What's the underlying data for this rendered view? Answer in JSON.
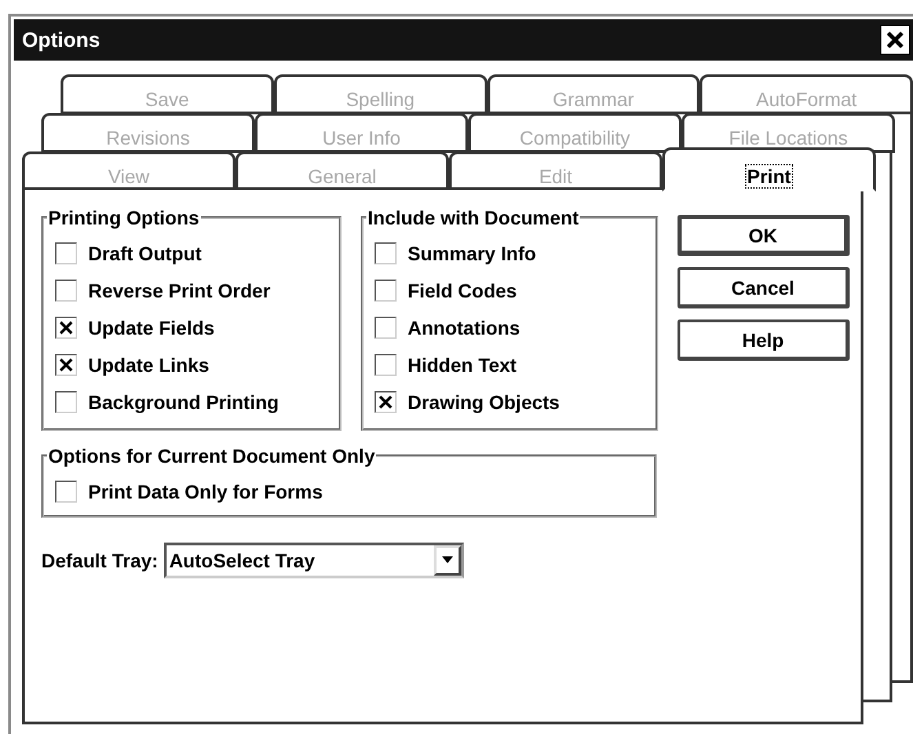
{
  "window": {
    "title": "Options"
  },
  "tab_rows": [
    {
      "tabs": [
        {
          "label": "Save",
          "selected": false,
          "disabled": true
        },
        {
          "label": "Spelling",
          "selected": false,
          "disabled": true
        },
        {
          "label": "Grammar",
          "selected": false,
          "disabled": true
        },
        {
          "label": "AutoFormat",
          "selected": false,
          "disabled": true
        }
      ]
    },
    {
      "tabs": [
        {
          "label": "Revisions",
          "selected": false,
          "disabled": true
        },
        {
          "label": "User Info",
          "selected": false,
          "disabled": true
        },
        {
          "label": "Compatibility",
          "selected": false,
          "disabled": true
        },
        {
          "label": "File Locations",
          "selected": false,
          "disabled": true
        }
      ]
    },
    {
      "tabs": [
        {
          "label": "View",
          "selected": false,
          "disabled": true
        },
        {
          "label": "General",
          "selected": false,
          "disabled": true
        },
        {
          "label": "Edit",
          "selected": false,
          "disabled": true
        },
        {
          "label": "Print",
          "selected": true,
          "disabled": false
        }
      ]
    }
  ],
  "printing_options": {
    "title": "Printing Options",
    "options": [
      {
        "label": "Draft Output",
        "checked": false
      },
      {
        "label": "Reverse Print Order",
        "checked": false
      },
      {
        "label": "Update Fields",
        "checked": true
      },
      {
        "label": "Update Links",
        "checked": true
      },
      {
        "label": "Background Printing",
        "checked": false
      }
    ]
  },
  "include_with_document": {
    "title": "Include with Document",
    "options": [
      {
        "label": "Summary Info",
        "checked": false
      },
      {
        "label": "Field Codes",
        "checked": false
      },
      {
        "label": "Annotations",
        "checked": false
      },
      {
        "label": "Hidden Text",
        "checked": false
      },
      {
        "label": "Drawing Objects",
        "checked": true
      }
    ]
  },
  "buttons": [
    {
      "label": "OK",
      "default": true
    },
    {
      "label": "Cancel",
      "default": false
    },
    {
      "label": "Help",
      "default": false
    }
  ],
  "current_document_options": {
    "title": "Options for Current Document Only",
    "options": [
      {
        "label": "Print Data Only for Forms",
        "checked": false
      }
    ]
  },
  "default_tray": {
    "label": "Default Tray:",
    "value": "AutoSelect Tray"
  }
}
